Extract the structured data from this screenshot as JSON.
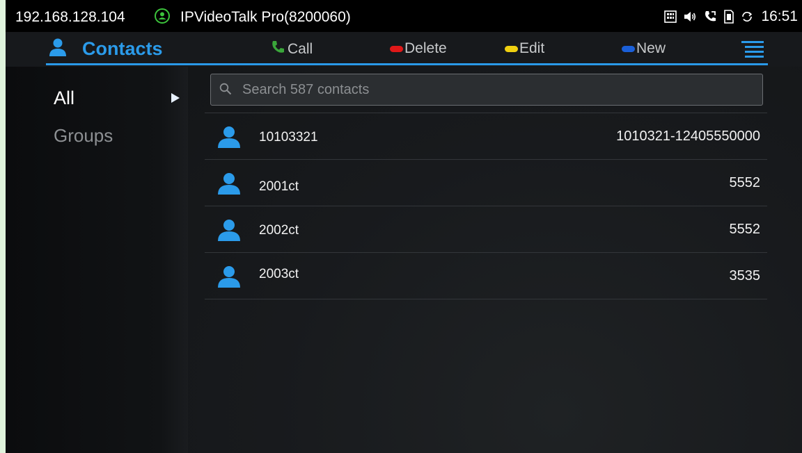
{
  "statusbar": {
    "ip": "192.168.128.104",
    "app_title": "IPVideoTalk Pro(8200060)",
    "time": "16:51",
    "icons": [
      "keypad-icon",
      "volume-icon",
      "call-forward-icon",
      "sd-card-icon",
      "sync-icon"
    ]
  },
  "actionbar": {
    "title": "Contacts",
    "call_label": "Call",
    "delete_label": "Delete",
    "edit_label": "Edit",
    "new_label": "New",
    "colors": {
      "accent": "#2b9bea",
      "call": "#3aa63a",
      "delete": "#e01818",
      "edit": "#f0d010",
      "new": "#1a5fd8"
    }
  },
  "sidebar": {
    "items": [
      {
        "label": "All",
        "selected": true
      },
      {
        "label": "Groups",
        "selected": false
      }
    ]
  },
  "search": {
    "placeholder": "Search 587 contacts"
  },
  "contacts": [
    {
      "name": "10103321",
      "number": "1010321-12405550000"
    },
    {
      "name": "2001ct",
      "number": "5552"
    },
    {
      "name": "2002ct",
      "number": "5552"
    },
    {
      "name": "2003ct",
      "number": "3535"
    }
  ]
}
